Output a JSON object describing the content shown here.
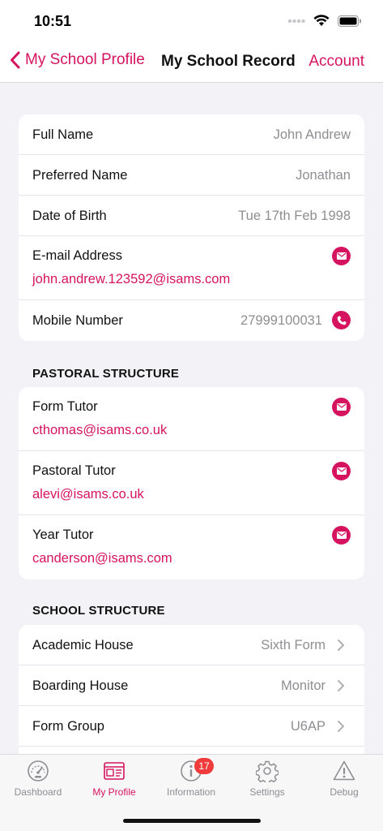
{
  "status": {
    "time": "10:51"
  },
  "nav": {
    "back_label": "My School Profile",
    "title": "My School Record",
    "action_label": "Account"
  },
  "personal": {
    "full_name_label": "Full Name",
    "full_name": "John Andrew",
    "preferred_label": "Preferred Name",
    "preferred": "Jonathan",
    "dob_label": "Date of Birth",
    "dob": "Tue 17th Feb 1998",
    "email_label": "E-mail Address",
    "email": "john.andrew.123592@isams.com",
    "mobile_label": "Mobile Number",
    "mobile": "27999100031"
  },
  "pastoral": {
    "header": "PASTORAL STRUCTURE",
    "items": [
      {
        "label": "Form Tutor",
        "email": "cthomas@isams.co.uk"
      },
      {
        "label": "Pastoral Tutor",
        "email": "alevi@isams.co.uk"
      },
      {
        "label": "Year Tutor",
        "email": "canderson@isams.com"
      }
    ]
  },
  "school": {
    "header": "SCHOOL STRUCTURE",
    "items": [
      {
        "label": "Academic House",
        "value": "Sixth Form"
      },
      {
        "label": "Boarding House",
        "value": "Monitor"
      },
      {
        "label": "Form Group",
        "value": "U6AP"
      }
    ]
  },
  "tabs": [
    {
      "label": "Dashboard",
      "icon": "gauge-icon"
    },
    {
      "label": "My Profile",
      "icon": "profile-card-icon",
      "active": true
    },
    {
      "label": "Information",
      "icon": "info-icon",
      "badge": "17"
    },
    {
      "label": "Settings",
      "icon": "gear-icon"
    },
    {
      "label": "Debug",
      "icon": "warning-icon"
    }
  ],
  "colors": {
    "accent": "#d5135f",
    "badge": "#ef3b3b",
    "background": "#f2f2f7"
  }
}
